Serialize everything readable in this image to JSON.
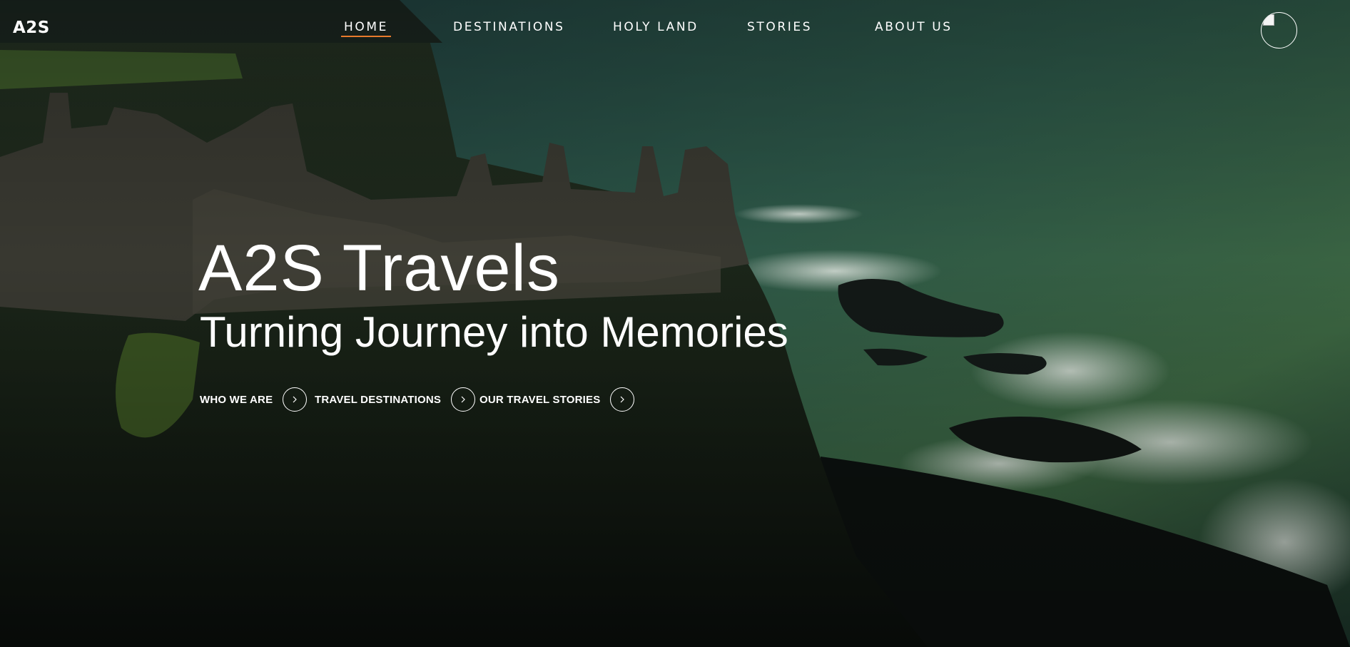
{
  "brand": {
    "logo_text": "A2S"
  },
  "nav": {
    "items": [
      {
        "label": "HOME",
        "active": true
      },
      {
        "label": "DESTINATIONS",
        "active": false
      },
      {
        "label": "HOLY LAND",
        "active": false
      },
      {
        "label": "STORIES",
        "active": false
      },
      {
        "label": "ABOUT US",
        "active": false
      }
    ],
    "active_indicator_color": "#e87a2c"
  },
  "profile": {
    "avatar_icon": "user-avatar-icon"
  },
  "hero": {
    "title": "A2S Travels",
    "subtitle": "Turning Journey into Memories",
    "ctas": [
      {
        "label": "WHO WE ARE",
        "icon": "chevron-right-icon"
      },
      {
        "label": "TRAVEL DESTINATIONS",
        "icon": "chevron-right-icon"
      },
      {
        "label": "OUR TRAVEL STORIES",
        "icon": "chevron-right-icon"
      }
    ]
  }
}
